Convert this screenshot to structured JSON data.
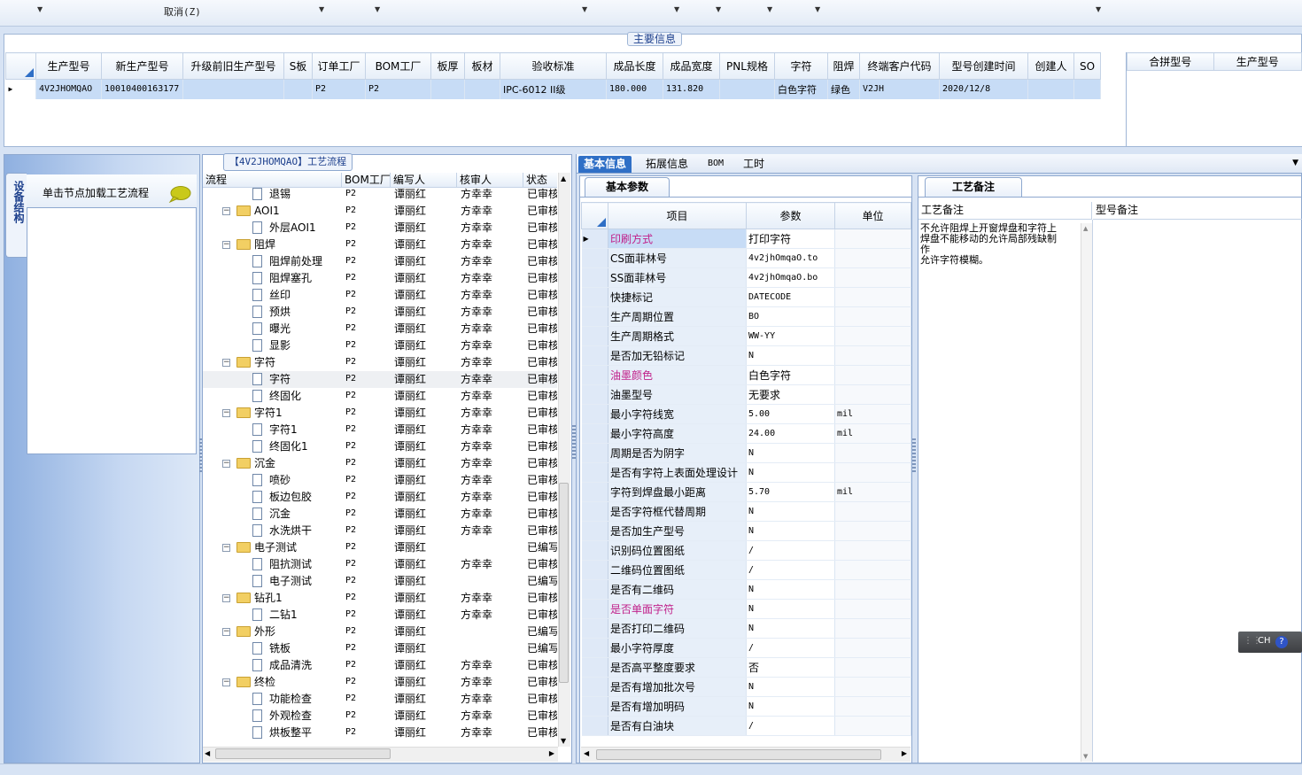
{
  "toolbar": {
    "cancel_label": "取消(Z)"
  },
  "main_info": {
    "label": "主要信息",
    "columns": [
      "生产型号",
      "新生产型号",
      "升级前旧生产型号",
      "S板",
      "订单工厂",
      "BOM工厂",
      "板厚",
      "板材",
      "验收标准",
      "成品长度",
      "成品宽度",
      "PNL规格",
      "字符",
      "阻焊",
      "终端客户代码",
      "型号创建时间",
      "创建人",
      "SO"
    ],
    "row": [
      "4V2JHOMQAO",
      "10010400163177",
      "",
      "",
      "P2",
      "P2",
      "",
      "",
      "IPC-6012 II级",
      "180.000",
      "131.820",
      "",
      "白色字符",
      "绿色",
      "V2JH",
      "2020/12/8",
      "",
      ""
    ],
    "side_columns": [
      "合拼型号",
      "生产型号"
    ]
  },
  "left_nav": {
    "tab_label": "设备结构",
    "hint": "单击节点加载工艺流程"
  },
  "tree": {
    "title": "【4V2JHOMQAO】工艺流程",
    "columns": [
      "流程",
      "BOM工厂",
      "编写人",
      "核审人",
      "状态"
    ],
    "rows": [
      {
        "name": "退锡",
        "level": 2,
        "bom": "P2",
        "writer": "谭丽红",
        "reviewer": "方幸幸",
        "status": "已审核"
      },
      {
        "name": "AOI1",
        "level": 1,
        "bom": "P2",
        "writer": "谭丽红",
        "reviewer": "方幸幸",
        "status": "已审核"
      },
      {
        "name": "外层AOI1",
        "level": 2,
        "bom": "P2",
        "writer": "谭丽红",
        "reviewer": "方幸幸",
        "status": "已审核"
      },
      {
        "name": "阻焊",
        "level": 1,
        "bom": "P2",
        "writer": "谭丽红",
        "reviewer": "方幸幸",
        "status": "已审核"
      },
      {
        "name": "阻焊前处理",
        "level": 2,
        "bom": "P2",
        "writer": "谭丽红",
        "reviewer": "方幸幸",
        "status": "已审核"
      },
      {
        "name": "阻焊塞孔",
        "level": 2,
        "bom": "P2",
        "writer": "谭丽红",
        "reviewer": "方幸幸",
        "status": "已审核"
      },
      {
        "name": "丝印",
        "level": 2,
        "bom": "P2",
        "writer": "谭丽红",
        "reviewer": "方幸幸",
        "status": "已审核"
      },
      {
        "name": "预烘",
        "level": 2,
        "bom": "P2",
        "writer": "谭丽红",
        "reviewer": "方幸幸",
        "status": "已审核"
      },
      {
        "name": "曝光",
        "level": 2,
        "bom": "P2",
        "writer": "谭丽红",
        "reviewer": "方幸幸",
        "status": "已审核"
      },
      {
        "name": "显影",
        "level": 2,
        "bom": "P2",
        "writer": "谭丽红",
        "reviewer": "方幸幸",
        "status": "已审核"
      },
      {
        "name": "字符",
        "level": 1,
        "bom": "P2",
        "writer": "谭丽红",
        "reviewer": "方幸幸",
        "status": "已审核"
      },
      {
        "name": "字符",
        "level": 2,
        "bom": "P2",
        "writer": "谭丽红",
        "reviewer": "方幸幸",
        "status": "已审核",
        "selected": true
      },
      {
        "name": "终固化",
        "level": 2,
        "bom": "P2",
        "writer": "谭丽红",
        "reviewer": "方幸幸",
        "status": "已审核"
      },
      {
        "name": "字符1",
        "level": 1,
        "bom": "P2",
        "writer": "谭丽红",
        "reviewer": "方幸幸",
        "status": "已审核"
      },
      {
        "name": "字符1",
        "level": 2,
        "bom": "P2",
        "writer": "谭丽红",
        "reviewer": "方幸幸",
        "status": "已审核"
      },
      {
        "name": "终固化1",
        "level": 2,
        "bom": "P2",
        "writer": "谭丽红",
        "reviewer": "方幸幸",
        "status": "已审核"
      },
      {
        "name": "沉金",
        "level": 1,
        "bom": "P2",
        "writer": "谭丽红",
        "reviewer": "方幸幸",
        "status": "已审核"
      },
      {
        "name": "喷砂",
        "level": 2,
        "bom": "P2",
        "writer": "谭丽红",
        "reviewer": "方幸幸",
        "status": "已审核"
      },
      {
        "name": "板边包胶",
        "level": 2,
        "bom": "P2",
        "writer": "谭丽红",
        "reviewer": "方幸幸",
        "status": "已审核"
      },
      {
        "name": "沉金",
        "level": 2,
        "bom": "P2",
        "writer": "谭丽红",
        "reviewer": "方幸幸",
        "status": "已审核"
      },
      {
        "name": "水洗烘干",
        "level": 2,
        "bom": "P2",
        "writer": "谭丽红",
        "reviewer": "方幸幸",
        "status": "已审核"
      },
      {
        "name": "电子测试",
        "level": 1,
        "bom": "P2",
        "writer": "谭丽红",
        "reviewer": "",
        "status": "已编写"
      },
      {
        "name": "阻抗测试",
        "level": 2,
        "bom": "P2",
        "writer": "谭丽红",
        "reviewer": "方幸幸",
        "status": "已审核"
      },
      {
        "name": "电子测试",
        "level": 2,
        "bom": "P2",
        "writer": "谭丽红",
        "reviewer": "",
        "status": "已编写"
      },
      {
        "name": "钻孔1",
        "level": 1,
        "bom": "P2",
        "writer": "谭丽红",
        "reviewer": "方幸幸",
        "status": "已审核"
      },
      {
        "name": "二钻1",
        "level": 2,
        "bom": "P2",
        "writer": "谭丽红",
        "reviewer": "方幸幸",
        "status": "已审核"
      },
      {
        "name": "外形",
        "level": 1,
        "bom": "P2",
        "writer": "谭丽红",
        "reviewer": "",
        "status": "已编写"
      },
      {
        "name": "铣板",
        "level": 2,
        "bom": "P2",
        "writer": "谭丽红",
        "reviewer": "",
        "status": "已编写"
      },
      {
        "name": "成品清洗",
        "level": 2,
        "bom": "P2",
        "writer": "谭丽红",
        "reviewer": "方幸幸",
        "status": "已审核"
      },
      {
        "name": "终检",
        "level": 1,
        "bom": "P2",
        "writer": "谭丽红",
        "reviewer": "方幸幸",
        "status": "已审核"
      },
      {
        "name": "功能检查",
        "level": 2,
        "bom": "P2",
        "writer": "谭丽红",
        "reviewer": "方幸幸",
        "status": "已审核"
      },
      {
        "name": "外观检查",
        "level": 2,
        "bom": "P2",
        "writer": "谭丽红",
        "reviewer": "方幸幸",
        "status": "已审核"
      },
      {
        "name": "烘板整平",
        "level": 2,
        "bom": "P2",
        "writer": "谭丽红",
        "reviewer": "方幸幸",
        "status": "已审核"
      }
    ]
  },
  "right_tabs": [
    {
      "label": "基本信息",
      "active": true
    },
    {
      "label": "拓展信息",
      "active": false
    },
    {
      "label": "BOM",
      "active": false
    },
    {
      "label": "工时",
      "active": false
    }
  ],
  "params": {
    "section_tab": "基本参数",
    "columns": [
      "项目",
      "参数",
      "单位"
    ],
    "rows": [
      {
        "item": "印刷方式",
        "value": "打印字符",
        "unit": "",
        "pink": true,
        "cn": true
      },
      {
        "item": "CS面菲林号",
        "value": "4v2jhOmqaO.to",
        "unit": ""
      },
      {
        "item": "SS面菲林号",
        "value": "4v2jhOmqaO.bo",
        "unit": ""
      },
      {
        "item": "快捷标记",
        "value": "DATECODE",
        "unit": ""
      },
      {
        "item": "生产周期位置",
        "value": "BO",
        "unit": ""
      },
      {
        "item": "生产周期格式",
        "value": "WW-YY",
        "unit": ""
      },
      {
        "item": "是否加无铅标记",
        "value": "N",
        "unit": ""
      },
      {
        "item": "油墨颜色",
        "value": "白色字符",
        "unit": "",
        "pink": true,
        "cn": true
      },
      {
        "item": "油墨型号",
        "value": "无要求",
        "unit": "",
        "cn": true
      },
      {
        "item": "最小字符线宽",
        "value": "5.00",
        "unit": "mil"
      },
      {
        "item": "最小字符高度",
        "value": "24.00",
        "unit": "mil"
      },
      {
        "item": "周期是否为阴字",
        "value": "N",
        "unit": ""
      },
      {
        "item": "是否有字符上表面处理设计",
        "value": "N",
        "unit": ""
      },
      {
        "item": "字符到焊盘最小距离",
        "value": "5.70",
        "unit": "mil"
      },
      {
        "item": "是否字符框代替周期",
        "value": "N",
        "unit": ""
      },
      {
        "item": "是否加生产型号",
        "value": "N",
        "unit": ""
      },
      {
        "item": "识别码位置图纸",
        "value": "/",
        "unit": ""
      },
      {
        "item": "二维码位置图纸",
        "value": "/",
        "unit": ""
      },
      {
        "item": "是否有二维码",
        "value": "N",
        "unit": ""
      },
      {
        "item": "是否单面字符",
        "value": "N",
        "unit": "",
        "pink": true
      },
      {
        "item": "是否打印二维码",
        "value": "N",
        "unit": ""
      },
      {
        "item": "最小字符厚度",
        "value": "/",
        "unit": ""
      },
      {
        "item": "是否高平整度要求",
        "value": "否",
        "unit": "",
        "cn": true
      },
      {
        "item": "是否有增加批次号",
        "value": "N",
        "unit": ""
      },
      {
        "item": "是否有增加明码",
        "value": "N",
        "unit": ""
      },
      {
        "item": "是否有白油块",
        "value": "/",
        "unit": ""
      }
    ]
  },
  "remarks": {
    "section_tab": "工艺备注",
    "col1": "工艺备注",
    "col2": "型号备注",
    "text": "不允许阻焊上开窗焊盘和字符上\n焊盘不能移动的允许局部残缺制\n作\n允许字符模糊。"
  },
  "ime": {
    "label": "CH"
  },
  "colors": {
    "accent": "#2f6fc6",
    "selected_row": "#c7dcf6",
    "pink_text": "#c0208a",
    "panel_bg": "#d7e3f4"
  }
}
